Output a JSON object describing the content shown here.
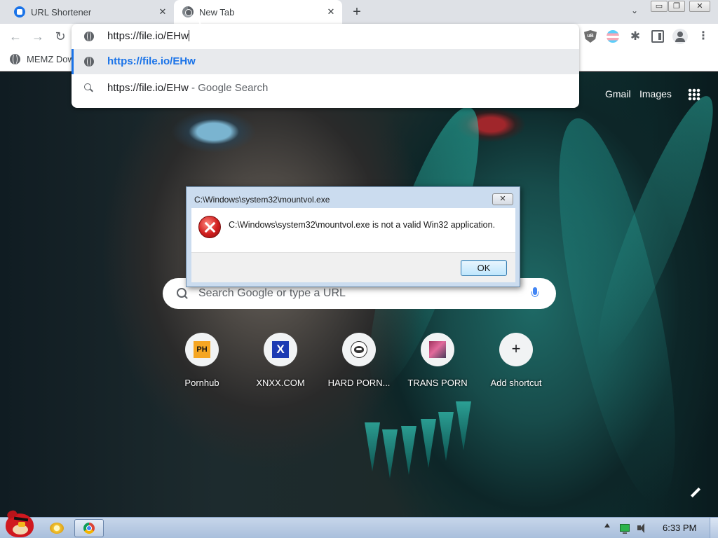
{
  "browser": {
    "tabs": [
      {
        "title": "URL Shortener",
        "favicon": "url-shortener-icon",
        "active": false
      },
      {
        "title": "New Tab",
        "favicon": "chrome-icon",
        "active": true
      }
    ],
    "tab_close_glyph": "✕",
    "new_tab_glyph": "+",
    "tab_search_glyph": "⌄",
    "window_buttons": {
      "minimize": "▭",
      "maximize": "❐",
      "close": "✕"
    }
  },
  "toolbar": {
    "back_glyph": "←",
    "forward_glyph": "→",
    "reload_glyph": "↻",
    "extensions": [
      "ublock-icon",
      "trans-flag-extension-icon",
      "puzzle-extensions-icon",
      "side-panel-icon"
    ],
    "ublock_text": "uB",
    "puzzle_glyph": "✱",
    "menu_glyph": "⋮"
  },
  "bookmarks": [
    {
      "label": "MEMZ Dow",
      "icon": "globe-icon"
    }
  ],
  "omnibox": {
    "input_value": "https://file.io/EHw",
    "suggestions": [
      {
        "text": "https://file.io/EHw",
        "icon": "globe-icon",
        "selected": true
      },
      {
        "text": "https://file.io/EHw",
        "suffix": " - Google Search",
        "icon": "search-icon",
        "selected": false
      }
    ]
  },
  "ntp": {
    "gmail": "Gmail",
    "images": "Images",
    "search_placeholder": "Search Google or type a URL",
    "shortcuts": [
      {
        "label": "Pornhub",
        "icon_text": "PH",
        "icon": "pornhub-icon"
      },
      {
        "label": "XNXX.COM",
        "icon": "xnxx-icon"
      },
      {
        "label": "HARD PORN...",
        "icon": "badger-icon"
      },
      {
        "label": "TRANS PORN",
        "icon": "trans-porn-icon"
      },
      {
        "label": "Add shortcut",
        "icon_text": "+",
        "icon": "add-icon"
      }
    ]
  },
  "dialog": {
    "title": "C:\\Windows\\system32\\mountvol.exe",
    "message": "C:\\Windows\\system32\\mountvol.exe is not a valid Win32 application.",
    "ok_label": "OK",
    "close_glyph": "✕"
  },
  "taskbar": {
    "pinned": [
      "angry-bird-start-icon",
      "explorer-icon",
      "chrome-icon"
    ],
    "clock": "6:33 PM"
  },
  "colors": {
    "accent": "#1a73e8",
    "tabstrip": "#dee1e6",
    "dialog_frame": "#cbdcef",
    "taskbar": "#b9cbe3"
  }
}
